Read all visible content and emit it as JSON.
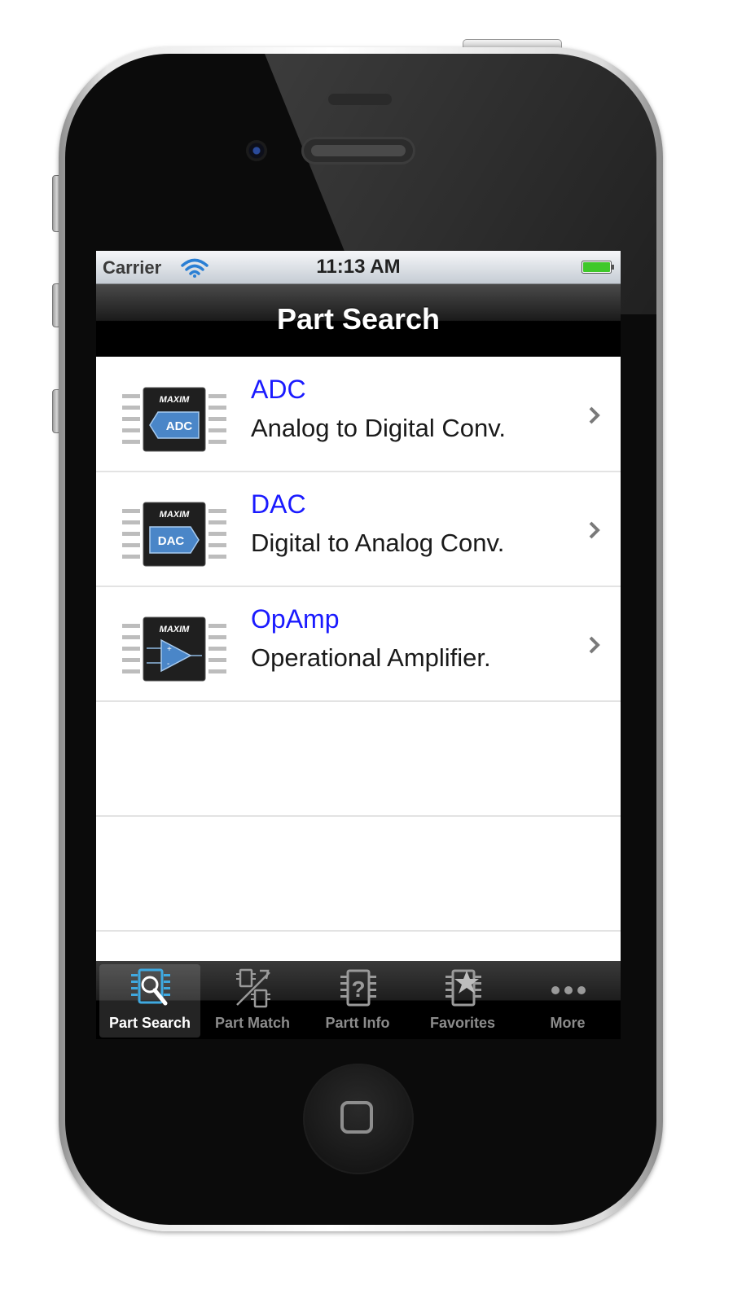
{
  "status_bar": {
    "carrier": "Carrier",
    "time": "11:13 AM"
  },
  "nav_bar": {
    "title": "Part Search"
  },
  "rows": [
    {
      "title": "ADC",
      "subtitle": "Analog to Digital Conv.",
      "chip_brand": "MAXIM",
      "chip_label": "ADC",
      "icon": "adc-chip-icon"
    },
    {
      "title": "DAC",
      "subtitle": "Digital to Analog Conv.",
      "chip_brand": "MAXIM",
      "chip_label": "DAC",
      "icon": "dac-chip-icon"
    },
    {
      "title": "OpAmp",
      "subtitle": "Operational Amplifier.",
      "chip_brand": "MAXIM",
      "chip_label": "",
      "icon": "opamp-chip-icon"
    }
  ],
  "tab_bar": {
    "tabs": [
      {
        "label": "Part Search",
        "icon": "chip-search-icon",
        "selected": true
      },
      {
        "label": "Part Match",
        "icon": "chip-match-icon",
        "selected": false
      },
      {
        "label": "Partt Info",
        "icon": "chip-info-icon",
        "selected": false
      },
      {
        "label": "Favorites",
        "icon": "chip-star-icon",
        "selected": false
      },
      {
        "label": "More",
        "icon": "more-dots-icon",
        "selected": false
      }
    ]
  },
  "colors": {
    "link_blue": "#1a1aff",
    "selected_tab_icon": "#3fa9e0",
    "chip_blue": "#4a86c8"
  }
}
